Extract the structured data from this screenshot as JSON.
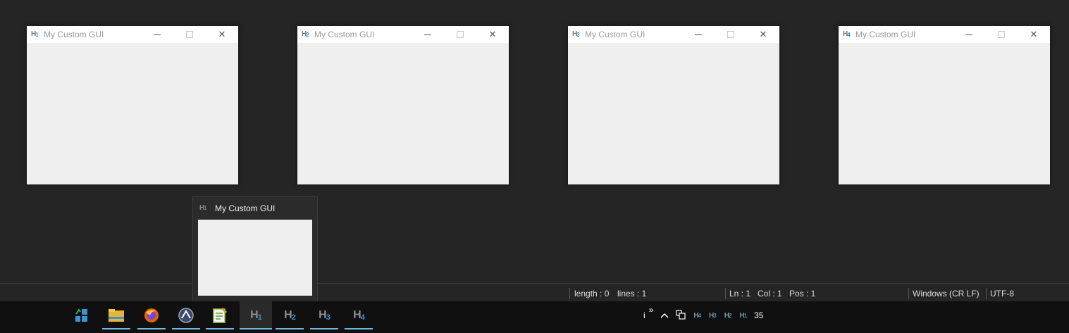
{
  "windows": [
    {
      "icon_num": "1",
      "title": "My Custom GUI"
    },
    {
      "icon_num": "2",
      "title": "My Custom GUI"
    },
    {
      "icon_num": "3",
      "title": "My Custom GUI"
    },
    {
      "icon_num": "4",
      "title": "My Custom GUI"
    }
  ],
  "window_controls": {
    "minimize": "minimize-icon",
    "maximize": "maximize-icon",
    "close": "close-icon",
    "close_glyph": "✕"
  },
  "status_bar": {
    "length": "length : 0",
    "lines": "lines : 1",
    "ln": "Ln : 1",
    "col": "Col : 1",
    "pos": "Pos : 1",
    "eol": "Windows (CR LF)",
    "encoding": "UTF-8"
  },
  "preview": {
    "icon_num": "1",
    "title": "My Custom GUI"
  },
  "taskbar": {
    "apps": [
      {
        "name": "task-view-icon"
      },
      {
        "name": "file-explorer-icon"
      },
      {
        "name": "firefox-icon"
      },
      {
        "name": "autohotkey-icon"
      },
      {
        "name": "notepad-plus-plus-icon"
      },
      {
        "name": "hgui-1-icon",
        "num": "1"
      },
      {
        "name": "hgui-2-icon",
        "num": "2"
      },
      {
        "name": "hgui-3-icon",
        "num": "3"
      },
      {
        "name": "hgui-4-icon",
        "num": "4"
      }
    ],
    "tray": {
      "info": "i",
      "chevron": "»",
      "up": "^",
      "icons": [
        "4",
        "3",
        "2",
        "1"
      ],
      "time": "35"
    }
  },
  "colors": {
    "accent": "#6fb8e6",
    "h_blue": "#3a93d4",
    "bg": "#252525",
    "taskbar": "#101010"
  }
}
